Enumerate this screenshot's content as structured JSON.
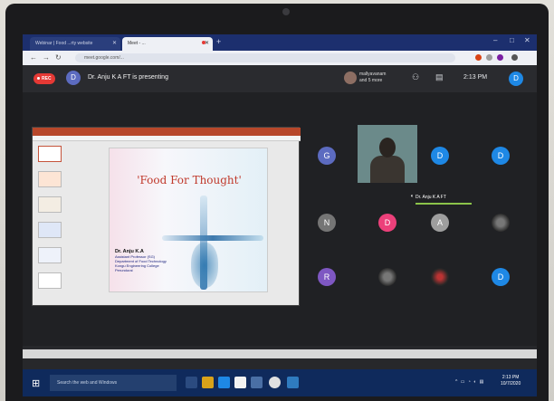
{
  "browser": {
    "tabs": [
      {
        "label": "Webinar | Food ...rty website"
      },
      {
        "label": "Meet - ..."
      }
    ],
    "url": "meet.google.com/..."
  },
  "meet": {
    "rec_label": "REC",
    "presenter_initial": "D",
    "presenting_text": "Dr. Anju K A FT is presenting",
    "self_name": "mallyavanam and 5 more",
    "time": "2:13 PM",
    "account_initial": "D"
  },
  "slide": {
    "title": "'Food For Thought'",
    "author_name": "Dr. Anju K.A",
    "author_lines": [
      "Assistant Professor (SG)",
      "Department of Food Technology",
      "Kongu Engineering College",
      "Perundurai"
    ]
  },
  "participants": [
    {
      "initial": "G",
      "color": "#5c6bc0"
    },
    {
      "initial": "D",
      "color": "#1e88e5"
    },
    {
      "initial": "D",
      "color": "#1e88e5"
    },
    {
      "initial": "N",
      "color": "#757575"
    },
    {
      "initial": "D",
      "color": "#ec407a"
    },
    {
      "initial": "A",
      "color": "#9e9e9e"
    },
    {
      "initial": "R",
      "color": "#7e57c2"
    },
    {
      "initial": "D",
      "color": "#1e88e5"
    }
  ],
  "featured_name": "Dr. Anju K A FT",
  "taskbar": {
    "search_placeholder": "Search the web and Windows",
    "clock_time": "2:13 PM",
    "clock_date": "10/7/2020"
  }
}
